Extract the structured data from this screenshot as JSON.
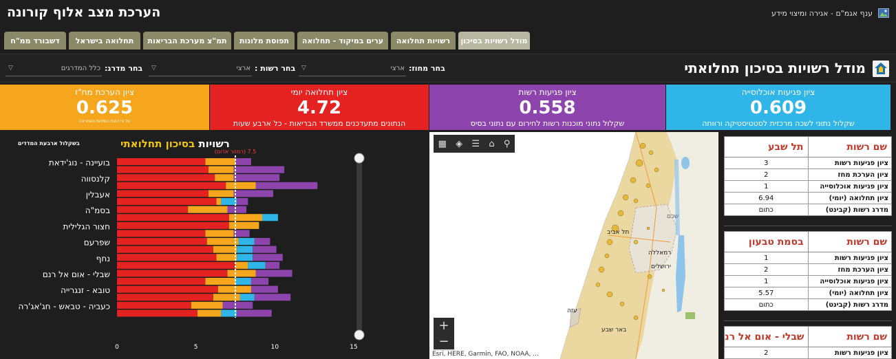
{
  "header": {
    "app_title": "הערכת מצב אלוף קורונה",
    "org_name": "ענף אגמ\"ם - אגירה ומיצוי מידע"
  },
  "tabs": [
    {
      "label": "מודל רשויות בסיכון",
      "active": true
    },
    {
      "label": "רשויות תחלואה",
      "active": false
    },
    {
      "label": "ערים במיקוד - תחלואה",
      "active": false
    },
    {
      "label": "תפוסת מלונות",
      "active": false
    },
    {
      "label": "תמ\"צ מערכת הבריאות",
      "active": false
    },
    {
      "label": "תחלואה בישראל",
      "active": false
    },
    {
      "label": "דשבורד ממ\"ח",
      "active": false
    }
  ],
  "filters": {
    "district_label": "בחר מחוז:",
    "district_value": "ארצי",
    "authority_label": "בחר רשות :",
    "authority_value": "ארצי",
    "rank_label": "בחר מדרג:",
    "rank_value": "כלל המדרגים"
  },
  "page_title": "מודל רשויות בסיכון תחלואתי",
  "kpis": [
    {
      "title": "ציון פגיעות אוכלוסייה",
      "value": "0.609",
      "subtitle": "שקלול נתוני לשכה מרכזית לסטטיסטיקה ורווחה",
      "color": "#2fb5e8"
    },
    {
      "title": "ציון פגיעות רשות",
      "value": "0.558",
      "subtitle": "שקלול נתוני מוכנות רשות לחירום עם נתוני בסיס",
      "color": "#8e44ad"
    },
    {
      "title": "ציון תחלואה יומי",
      "value": "4.72",
      "subtitle": "הנתונים מתעדכנים ממשרד הבריאות - כל ארבע שעות",
      "color": "#e52222"
    },
    {
      "title": "ציון הערכת מח\"ז",
      "value": "0.625",
      "subtitle": "על פי הזנת השיחות האחרונה",
      "color": "#f5a61d"
    }
  ],
  "chart": {
    "title_prefix": "רשויות",
    "title_highlight": "בסיכון תחלואתי",
    "subtitle": "בשקלול ארבעת המדדים",
    "threshold_label": "(רמזור אדום) 7.5"
  },
  "chart_data": {
    "type": "bar",
    "orientation": "horizontal",
    "stacked": true,
    "xlim": [
      0,
      15
    ],
    "xticks": [
      0,
      5,
      10,
      15
    ],
    "threshold": 7.5,
    "categories": [
      "בועיינה - נוג'ידאת",
      "",
      "קלנסווה",
      "",
      "אעבלין",
      "",
      "בסמ\"ה",
      "",
      "חצור הגלילית",
      "",
      "שפרעם",
      "",
      "נחף",
      "",
      "שבלי - אום אל רנם",
      "",
      "טובא - זנגרייה",
      "",
      "כעביה - טבאש - חג'אג'רה",
      ""
    ],
    "series": [
      {
        "color": "#e52222",
        "values": [
          5.6,
          5.8,
          6.2,
          6.9,
          5.8,
          6.3,
          4.5,
          7.1,
          7.1,
          5.6,
          5.7,
          6.1,
          6.3,
          7.5,
          7.0,
          5.6,
          6.4,
          6.1,
          4.7,
          5.1
        ]
      },
      {
        "color": "#f5a61d",
        "values": [
          1.9,
          1.6,
          1.2,
          1.9,
          1.6,
          0.3,
          2.5,
          2.1,
          1.9,
          1.8,
          2.0,
          1.5,
          1.3,
          0.8,
          1.8,
          1.9,
          2.1,
          1.7,
          2.0,
          1.5
        ]
      },
      {
        "color": "#2fb5e8",
        "values": [
          0,
          0,
          0,
          0,
          0,
          1.0,
          0,
          1.0,
          0,
          0,
          1.0,
          1.0,
          1.0,
          1.1,
          0,
          1.0,
          0,
          0.9,
          0,
          1.0
        ]
      },
      {
        "color": "#8e44ad",
        "values": [
          1.0,
          3.2,
          2.9,
          3.9,
          2.5,
          0.7,
          1.2,
          0,
          0,
          1.0,
          1.0,
          1.5,
          1.9,
          0.9,
          2.3,
          1.1,
          1.7,
          2.3,
          1.9,
          2.2
        ]
      }
    ]
  },
  "map": {
    "attribution": "Esri, HERE, Garmin, FAO, NOAA, ...",
    "labels": [
      "תל אביב",
      "רמאללה",
      "ירושלים",
      "עזה",
      "באר שבע",
      "שכם"
    ]
  },
  "tables": [
    {
      "header_label": "שם רשות",
      "name": "תל שבע",
      "rows": [
        {
          "label": "ציון פגיעות רשות",
          "value": "3"
        },
        {
          "label": "ציון הערכת מחז",
          "value": "2"
        },
        {
          "label": "ציון פגיעות אוכלוסייה",
          "value": "1"
        },
        {
          "label": "ציון תחלואה (יומי)",
          "value": "6.94"
        },
        {
          "label": "מדרג רשות (קבינט)",
          "value": "כתום"
        }
      ]
    },
    {
      "header_label": "שם רשות",
      "name": "בסמת טבעון",
      "rows": [
        {
          "label": "ציון פגיעות רשות",
          "value": "1"
        },
        {
          "label": "ציון הערכת מחז",
          "value": "2"
        },
        {
          "label": "ציון פגיעות אוכלוסייה",
          "value": "1"
        },
        {
          "label": "ציון תחלואה (יומי)",
          "value": "5.57"
        },
        {
          "label": "מדרג רשות (קבינט)",
          "value": "כתום"
        }
      ]
    },
    {
      "header_label": "שם רשות",
      "name": "שבלי - אום אל רנם",
      "rows": [
        {
          "label": "ציון פגיעות רשות",
          "value": "2"
        }
      ]
    }
  ],
  "icons": {
    "logo": "broken-image-icon",
    "title": "home-shield-icon",
    "map_tools": [
      "qr-code-icon",
      "layers-icon",
      "list-icon",
      "home-icon",
      "search-icon"
    ]
  }
}
